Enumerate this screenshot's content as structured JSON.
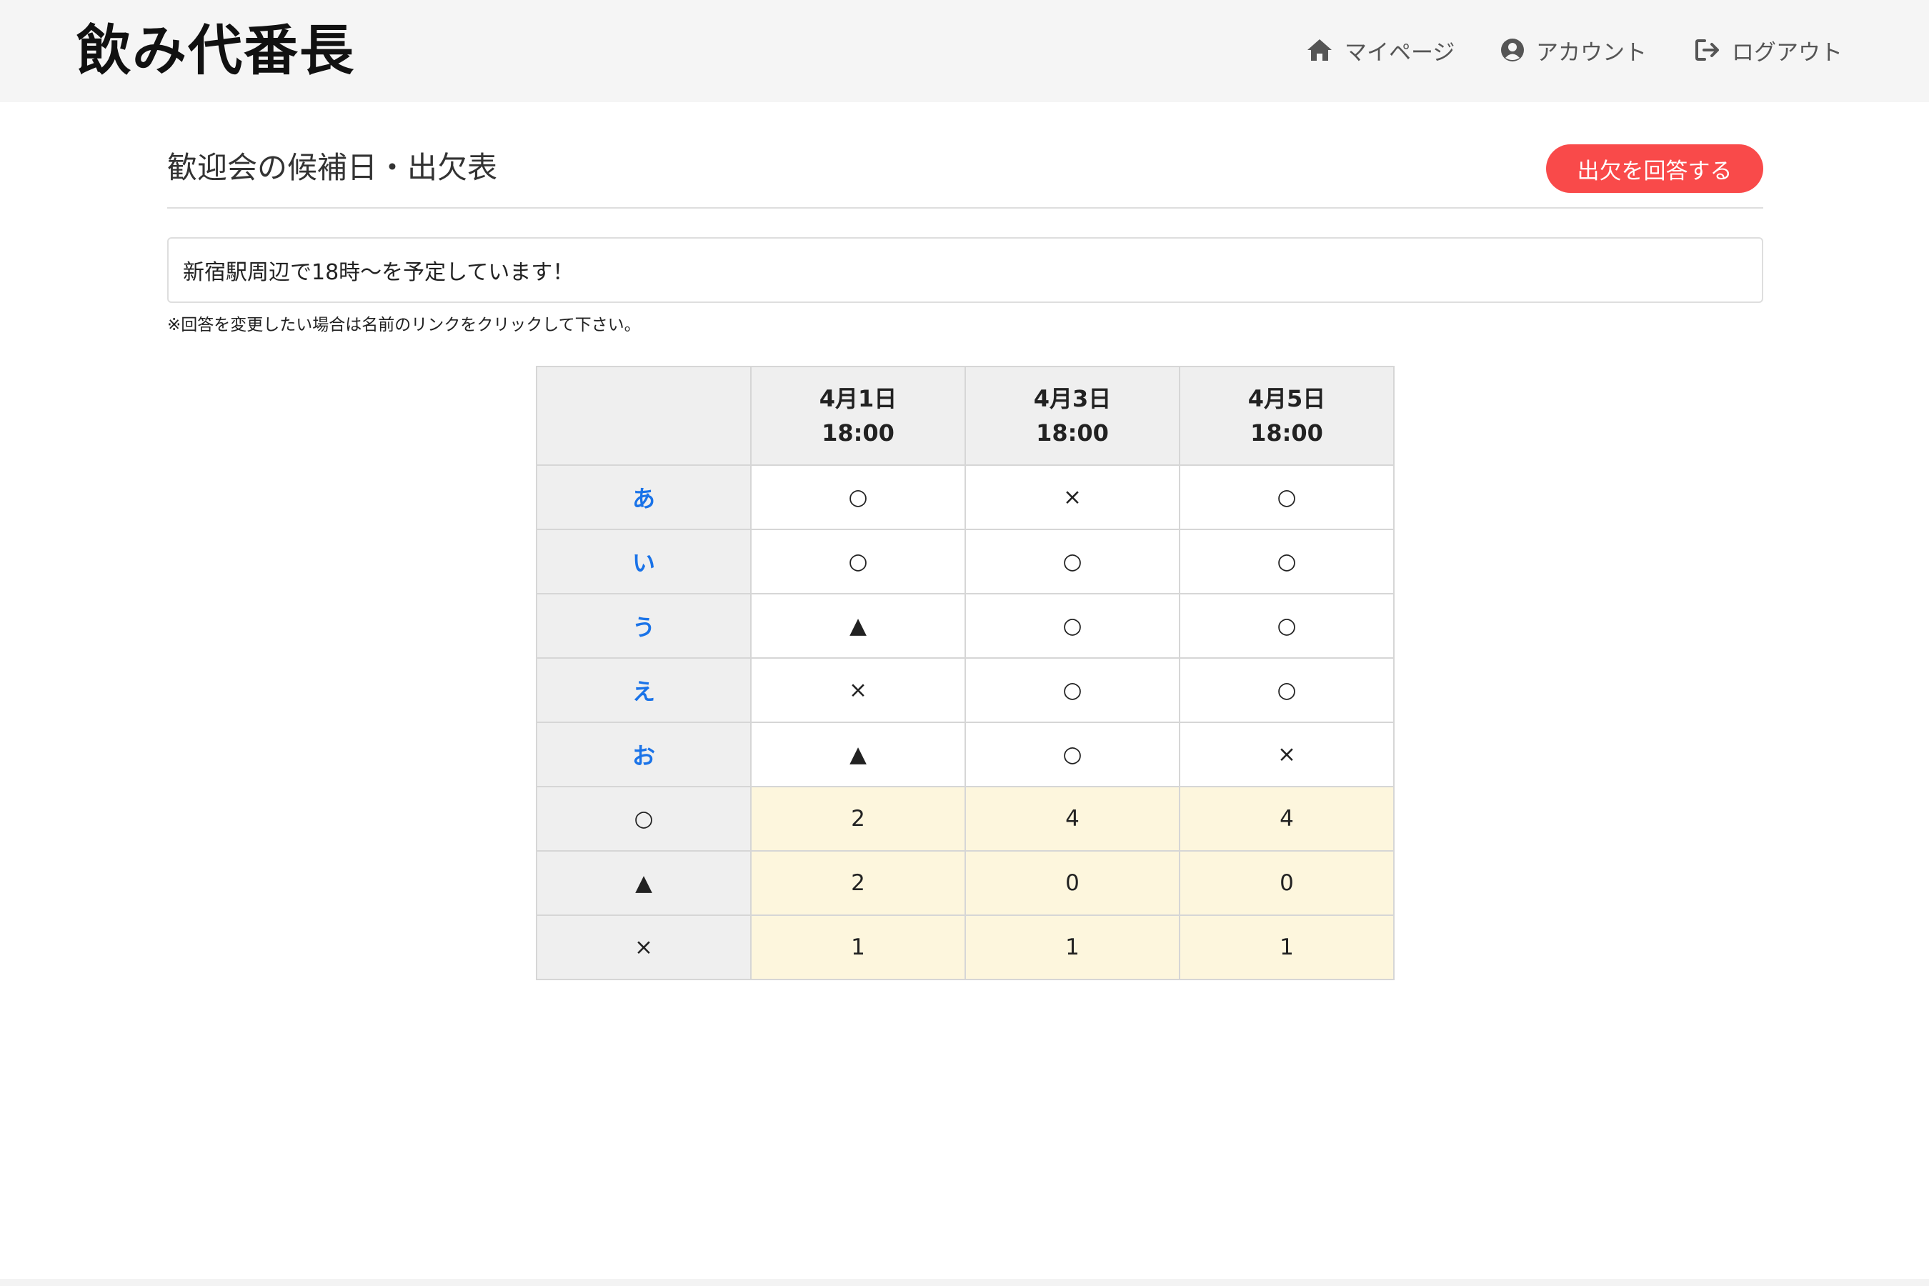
{
  "header": {
    "logo": "飲み代番長",
    "nav": {
      "mypage": "マイページ",
      "account": "アカウント",
      "logout": "ログアウト"
    }
  },
  "main": {
    "title": "歓迎会の候補日・出欠表",
    "answer_button": "出欠を回答する",
    "memo": "新宿駅周辺で18時〜を予定しています！",
    "note": "※回答を変更したい場合は名前のリンクをクリックして下さい。"
  },
  "table": {
    "dates": [
      {
        "date": "4月1日",
        "time": "18:00"
      },
      {
        "date": "4月3日",
        "time": "18:00"
      },
      {
        "date": "4月5日",
        "time": "18:00"
      }
    ],
    "rows": [
      {
        "name": "あ",
        "answers": [
          "○",
          "×",
          "○"
        ]
      },
      {
        "name": "い",
        "answers": [
          "○",
          "○",
          "○"
        ]
      },
      {
        "name": "う",
        "answers": [
          "▲",
          "○",
          "○"
        ]
      },
      {
        "name": "え",
        "answers": [
          "×",
          "○",
          "○"
        ]
      },
      {
        "name": "お",
        "answers": [
          "▲",
          "○",
          "×"
        ]
      }
    ],
    "totals": [
      {
        "symbol": "○",
        "counts": [
          "2",
          "4",
          "4"
        ]
      },
      {
        "symbol": "▲",
        "counts": [
          "2",
          "0",
          "0"
        ]
      },
      {
        "symbol": "×",
        "counts": [
          "1",
          "1",
          "1"
        ]
      }
    ]
  },
  "colors": {
    "accent_button": "#f94a4a",
    "name_link": "#1a73e8",
    "total_bg": "#fdf6dd",
    "header_bg": "#f5f5f5"
  }
}
